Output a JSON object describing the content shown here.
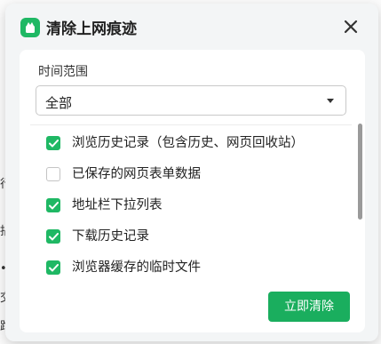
{
  "dialog": {
    "title": "清除上网痕迹",
    "app_icon": "app-logo-icon",
    "close_icon": "close-icon"
  },
  "time_range": {
    "label": "时间范围",
    "selected": "全部",
    "caret_icon": "caret-down-icon"
  },
  "options": [
    {
      "label": "浏览历史记录（包含历史、网页回收站）",
      "checked": true
    },
    {
      "label": "已保存的网页表单数据",
      "checked": false
    },
    {
      "label": "地址栏下拉列表",
      "checked": true
    },
    {
      "label": "下载历史记录",
      "checked": true
    },
    {
      "label": "浏览器缓存的临时文件",
      "checked": true
    }
  ],
  "actions": {
    "clear_label": "立即清除"
  },
  "background": {
    "fragments": [
      "行",
      "拈",
      "•",
      "交",
      "跑"
    ]
  },
  "colors": {
    "accent": "#1fb864",
    "button": "#1aae5e",
    "dialog_bg": "#f3f5f6",
    "panel_bg": "#ffffff"
  }
}
